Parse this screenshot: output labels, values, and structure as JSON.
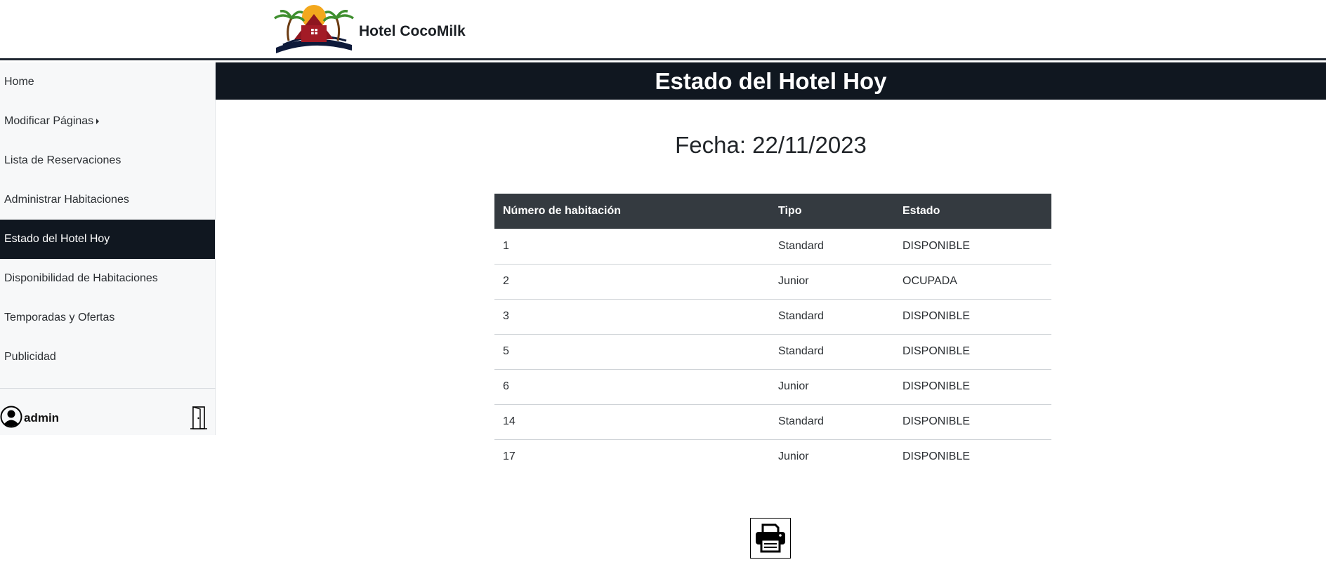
{
  "brand": {
    "name": "Hotel CocoMilk",
    "logo": "hotel-palm-sunset-logo"
  },
  "sidebar": {
    "items": [
      {
        "label": "Home"
      },
      {
        "label": "Modificar Páginas"
      },
      {
        "label": "Lista de Reservaciones"
      },
      {
        "label": "Administrar Habitaciones"
      },
      {
        "label": "Estado del Hotel Hoy"
      },
      {
        "label": "Disponibilidad de Habitaciones"
      },
      {
        "label": "Temporadas y Ofertas"
      },
      {
        "label": "Publicidad"
      }
    ],
    "active_index": 4,
    "user": {
      "name": "admin",
      "icon": "user-circle-icon",
      "logout_icon": "door-icon"
    }
  },
  "main": {
    "title": "Estado del Hotel Hoy",
    "date_text": "Fecha: 22/11/2023",
    "table": {
      "headers": [
        "Número de habitación",
        "Tipo",
        "Estado"
      ],
      "rows": [
        [
          "1",
          "Standard",
          "DISPONIBLE"
        ],
        [
          "2",
          "Junior",
          "OCUPADA"
        ],
        [
          "3",
          "Standard",
          "DISPONIBLE"
        ],
        [
          "5",
          "Standard",
          "DISPONIBLE"
        ],
        [
          "6",
          "Junior",
          "DISPONIBLE"
        ],
        [
          "14",
          "Standard",
          "DISPONIBLE"
        ],
        [
          "17",
          "Junior",
          "DISPONIBLE"
        ]
      ]
    },
    "print_icon": "printer-icon"
  },
  "colors": {
    "dark_band": "#101720",
    "table_header": "#343a40",
    "sidebar_bg": "#f7f8f9"
  }
}
